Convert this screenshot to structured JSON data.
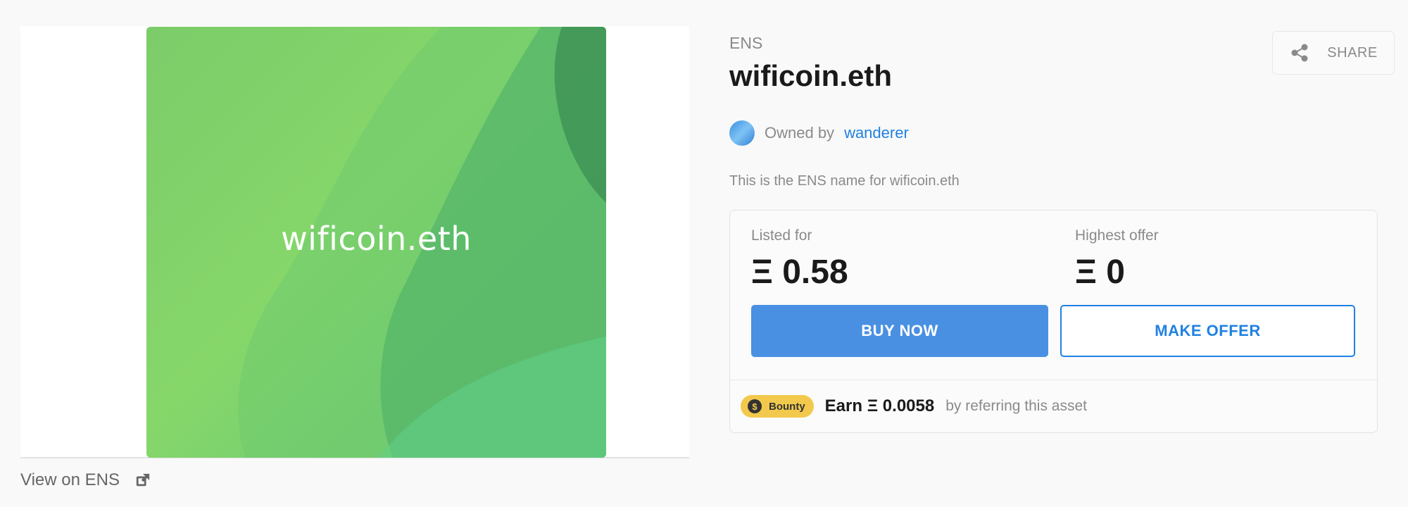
{
  "asset": {
    "image_label": "wificoin.eth",
    "view_link_label": "View on ENS",
    "collection": "ENS",
    "title": "wificoin.eth",
    "owner_prefix": "Owned by",
    "owner_name": "wanderer",
    "description": "This is the ENS name for wificoin.eth"
  },
  "share": {
    "label": "SHARE",
    "icon": "share-icon"
  },
  "trade": {
    "listed_label": "Listed for",
    "listed_value": "Ξ 0.58",
    "offer_label": "Highest offer",
    "offer_value": "Ξ 0",
    "buy_label": "BUY NOW",
    "make_offer_label": "MAKE OFFER"
  },
  "bounty": {
    "badge_label": "Bounty",
    "coin_symbol": "$",
    "earn_amount": "Earn Ξ 0.0058",
    "earn_suffix": "by referring this asset"
  },
  "colors": {
    "accent": "#2081e2",
    "buy_button": "#4a90e2",
    "bounty_badge": "#f2c94c",
    "art_green": "#7ccc6a"
  }
}
